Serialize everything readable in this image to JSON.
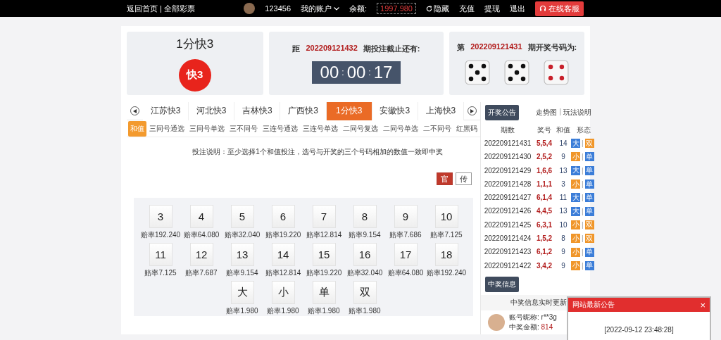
{
  "topbar": {
    "links": [
      "返回首页",
      "全部彩票"
    ],
    "separator": "|",
    "username": "123456",
    "account_menu": "我的账户",
    "balance_label": "余额:",
    "balance": "1997.980",
    "hide": "隐藏",
    "actions": [
      "充值",
      "提现",
      "退出"
    ],
    "service": "在线客服"
  },
  "game_card": {
    "title": "1分快3",
    "logo_text": "快3"
  },
  "countdown_card": {
    "prefix": "距",
    "period": "202209121432",
    "suffix": "期投注截止还有:",
    "time": [
      "00",
      "00",
      "17"
    ],
    "separator": ":"
  },
  "draw_card": {
    "prefix": "第",
    "period": "202209121431",
    "suffix": "期开奖号码为:",
    "dice": [
      {
        "kind": "five"
      },
      {
        "kind": "five"
      },
      {
        "kind": "four"
      }
    ]
  },
  "game_tabs": [
    {
      "label": "江苏快3",
      "selected": false
    },
    {
      "label": "河北快3",
      "selected": false
    },
    {
      "label": "吉林快3",
      "selected": false
    },
    {
      "label": "广西快3",
      "selected": false
    },
    {
      "label": "1分快3",
      "selected": true
    },
    {
      "label": "安徽快3",
      "selected": false
    },
    {
      "label": "上海快3",
      "selected": false
    }
  ],
  "play_tabs": [
    {
      "label": "和值",
      "selected": true
    },
    {
      "label": "三同号通选",
      "selected": false
    },
    {
      "label": "三同号单选",
      "selected": false
    },
    {
      "label": "三不同号",
      "selected": false
    },
    {
      "label": "三连号通选",
      "selected": false
    },
    {
      "label": "三连号单选",
      "selected": false
    },
    {
      "label": "二同号复选",
      "selected": false
    },
    {
      "label": "二同号单选",
      "selected": false
    },
    {
      "label": "二不同号",
      "selected": false
    },
    {
      "label": "红黑码",
      "selected": false
    }
  ],
  "note": "投注说明：至少选择1个和值投注，选号与开奖的三个号码相加的数值一致即中奖",
  "mode_toggle": [
    {
      "label": "官",
      "selected": true
    },
    {
      "label": "传",
      "selected": false
    }
  ],
  "bet_rows": [
    [
      {
        "label": "3",
        "odds": "赔率192.240"
      },
      {
        "label": "4",
        "odds": "赔率64.080"
      },
      {
        "label": "5",
        "odds": "赔率32.040"
      },
      {
        "label": "6",
        "odds": "赔率19.220"
      },
      {
        "label": "7",
        "odds": "赔率12.814"
      },
      {
        "label": "8",
        "odds": "赔率9.154"
      },
      {
        "label": "9",
        "odds": "赔率7.686"
      },
      {
        "label": "10",
        "odds": "赔率7.125"
      }
    ],
    [
      {
        "label": "11",
        "odds": "赔率7.125"
      },
      {
        "label": "12",
        "odds": "赔率7.687"
      },
      {
        "label": "13",
        "odds": "赔率9.154"
      },
      {
        "label": "14",
        "odds": "赔率12.814"
      },
      {
        "label": "15",
        "odds": "赔率19.220"
      },
      {
        "label": "16",
        "odds": "赔率32.040"
      },
      {
        "label": "17",
        "odds": "赔率64.080"
      },
      {
        "label": "18",
        "odds": "赔率192.240"
      }
    ],
    [
      {
        "label": "大",
        "odds": "赔率1.980"
      },
      {
        "label": "小",
        "odds": "赔率1.980"
      },
      {
        "label": "单",
        "odds": "赔率1.980"
      },
      {
        "label": "双",
        "odds": "赔率1.980"
      }
    ]
  ],
  "results": {
    "title": "开奖公告",
    "links": [
      "走势图",
      "玩法说明"
    ],
    "separator": "|",
    "tag_separator": "|",
    "columns": [
      "期数",
      "奖号",
      "和值",
      "形态"
    ],
    "rows": [
      {
        "period": "202209121431",
        "numbers": "5,5,4",
        "sum": "14",
        "size": {
          "label": "大",
          "color": "#3b7dd8"
        },
        "parity": {
          "label": "双",
          "color": "#f0962a"
        }
      },
      {
        "period": "202209121430",
        "numbers": "2,5,2",
        "sum": "9",
        "size": {
          "label": "小",
          "color": "#f0962a"
        },
        "parity": {
          "label": "单",
          "color": "#3b7dd8"
        }
      },
      {
        "period": "202209121429",
        "numbers": "1,6,6",
        "sum": "13",
        "size": {
          "label": "大",
          "color": "#3b7dd8"
        },
        "parity": {
          "label": "单",
          "color": "#3b7dd8"
        }
      },
      {
        "period": "202209121428",
        "numbers": "1,1,1",
        "sum": "3",
        "size": {
          "label": "小",
          "color": "#f0962a"
        },
        "parity": {
          "label": "单",
          "color": "#3b7dd8"
        }
      },
      {
        "period": "202209121427",
        "numbers": "6,1,4",
        "sum": "11",
        "size": {
          "label": "大",
          "color": "#3b7dd8"
        },
        "parity": {
          "label": "单",
          "color": "#3b7dd8"
        }
      },
      {
        "period": "202209121426",
        "numbers": "4,4,5",
        "sum": "13",
        "size": {
          "label": "大",
          "color": "#3b7dd8"
        },
        "parity": {
          "label": "单",
          "color": "#3b7dd8"
        }
      },
      {
        "period": "202209121425",
        "numbers": "6,3,1",
        "sum": "10",
        "size": {
          "label": "小",
          "color": "#f0962a"
        },
        "parity": {
          "label": "双",
          "color": "#f0962a"
        }
      },
      {
        "period": "202209121424",
        "numbers": "1,5,2",
        "sum": "8",
        "size": {
          "label": "小",
          "color": "#f0962a"
        },
        "parity": {
          "label": "双",
          "color": "#f0962a"
        }
      },
      {
        "period": "202209121423",
        "numbers": "6,1,2",
        "sum": "9",
        "size": {
          "label": "小",
          "color": "#f0962a"
        },
        "parity": {
          "label": "单",
          "color": "#3b7dd8"
        }
      },
      {
        "period": "202209121422",
        "numbers": "3,4,2",
        "sum": "9",
        "size": {
          "label": "小",
          "color": "#f0962a"
        },
        "parity": {
          "label": "单",
          "color": "#3b7dd8"
        }
      }
    ]
  },
  "winners": {
    "title": "中奖信息",
    "header": "中奖信息实时更新",
    "items": [
      {
        "nickname_label": "账号昵称:",
        "nickname": "r**3g",
        "amount_label": "中奖金额:",
        "amount": "814"
      }
    ]
  },
  "popup": {
    "title": "网站最新公告",
    "close": "×",
    "body": "[2022-09-12 23:48:28]"
  }
}
